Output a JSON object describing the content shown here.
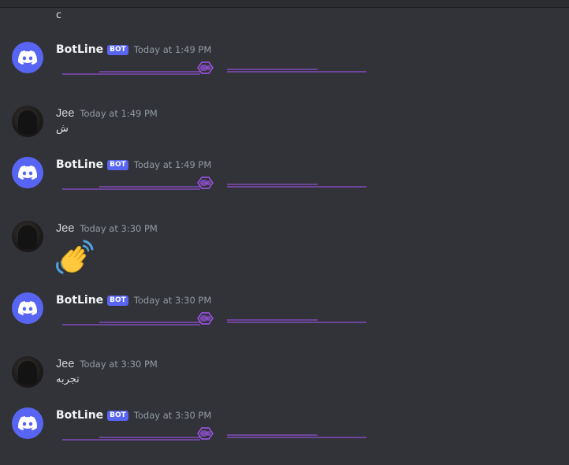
{
  "channel": {
    "first_message_text": "c"
  },
  "messages": [
    {
      "type": "bot",
      "username": "BotLine",
      "badge": "BOT",
      "time": "Today at 1:49 PM",
      "content": ""
    },
    {
      "type": "user",
      "username": "Jee",
      "time": "Today at 1:49 PM",
      "content": "ش"
    },
    {
      "type": "bot",
      "username": "BotLine",
      "badge": "BOT",
      "time": "Today at 1:49 PM",
      "content": ""
    },
    {
      "type": "user",
      "username": "Jee",
      "time": "Today at 3:30 PM",
      "content": "waving-hand-emoji"
    },
    {
      "type": "bot",
      "username": "BotLine",
      "badge": "BOT",
      "time": "Today at 3:30 PM",
      "content": ""
    },
    {
      "type": "user",
      "username": "Jee",
      "time": "Today at 3:30 PM",
      "content": "تجربه"
    },
    {
      "type": "bot",
      "username": "BotLine",
      "badge": "BOT",
      "time": "Today at 3:30 PM",
      "content": ""
    }
  ],
  "colors": {
    "background": "#313338",
    "bot_avatar": "#5865f2",
    "divider": "#a855f7"
  },
  "icons": [
    "discord-logo-icon",
    "hexagon-ornament-icon",
    "waving-hand-emoji"
  ]
}
